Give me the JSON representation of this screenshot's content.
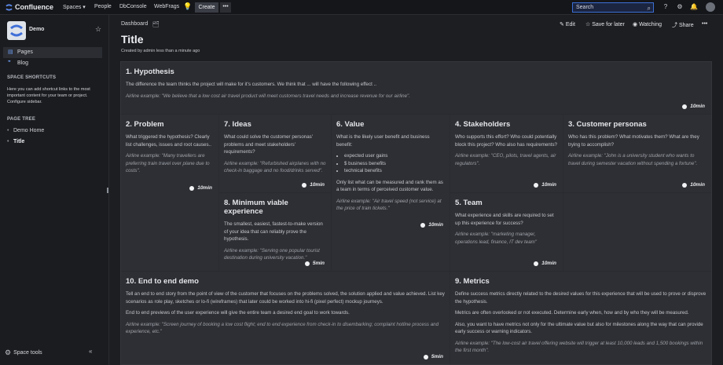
{
  "topnav": {
    "brand": "Confluence",
    "items": [
      "Spaces ▾",
      "People",
      "DbConsole",
      "WebFrags"
    ],
    "create": "Create",
    "more": "•••",
    "search_placeholder": "Search",
    "icons": [
      "lightbulb-icon",
      "help-icon",
      "settings-icon",
      "notifications-icon",
      "avatar"
    ]
  },
  "sidebar": {
    "space_name": "Demo",
    "nav": [
      {
        "label": "Pages",
        "icon": "pages-icon"
      },
      {
        "label": "Blog",
        "icon": "blog-icon"
      }
    ],
    "shortcuts_head": "SPACE SHORTCUTS",
    "shortcuts_text": "Here you can add shortcut links to the most important content for your team or project. Configure sidebar.",
    "tree_head": "PAGE TREE",
    "tree": [
      "Demo Home",
      "Title"
    ],
    "space_tools": "Space tools",
    "collapse": "«"
  },
  "page": {
    "breadcrumb": "Dashboard",
    "actions": {
      "edit": "Edit",
      "save": "Save for later",
      "watch": "Watching",
      "share": "Share",
      "more": "•••"
    },
    "title": "Title",
    "byline": "Created by admin less than a minute ago"
  },
  "cards": {
    "hypothesis": {
      "title": "1. Hypothesis",
      "text": "The difference the team thinks the project will make for it's customers. We think that ... will have the following effect ..",
      "example": "Airline example: \"We believe that a low cost air travel product will meet customers travel needs and increase revenue for our airline\".",
      "time": "10min"
    },
    "problem": {
      "title": "2. Problem",
      "text": "What triggered the hypothesis? Clearly list challenges, issues and root causes..",
      "example": "Airline example: \"Many travellers are preferring train travel over plane due to costs\".",
      "time": "10min"
    },
    "ideas": {
      "title": "7. Ideas",
      "text": "What could solve the customer personas' problems and meet stakeholders' requirements?",
      "example": "Airline example: \"Refurbished airplanes with no check-in baggage and no food/drinks served\".",
      "time": "10min"
    },
    "value": {
      "title": "6. Value",
      "text": "What is the likely user benefit and business benefit:",
      "bullets": [
        "expected user gains",
        "$ business benefits",
        "technical benefits"
      ],
      "text2": "Only list what can be measured and rank them as a team in terms of perceived customer value.",
      "example": "Airline example: \"Air travel speed (not service) at the price of train tickets.\"",
      "time": "10min"
    },
    "stakeholders": {
      "title": "4. Stakeholders",
      "text": "Who supports this effort? Who could potentially block this project? Who also has requirements?",
      "example": "Airline example: \"CEO, pilots, travel agents, air regulators\".",
      "time": "10min"
    },
    "personas": {
      "title": "3. Customer personas",
      "text": "Who has this problem? What motivates them? What are they trying to accomplish?",
      "example": "Airline example: \"John is a university student who wants to travel during semester vacation without spending a fortune\".",
      "time": "10min"
    },
    "mvp": {
      "title": "8. Minimum viable experience",
      "text": "The smallest, easiest, fastest-to-make version of your idea that can reliably prove the hypothesis.",
      "example": "Airline example: \"Serving one popular tourist destination during university vacation.\"",
      "time": "5min"
    },
    "team": {
      "title": "5. Team",
      "text": "What experience and skills are required to set up this experience for success?",
      "example": "Airline example: \"marketing manager, operations lead, finance, IT dev team\"",
      "time": "10min"
    },
    "demo": {
      "title": "10. End to end demo",
      "text": "Tell an end to end story from the point of view of the customer that focuses on the problems solved, the solution applied and value achieved. List key scenarios as role play, sketches or lo-fi (wireframes) that later could be worked into hi-fi (pixel perfect) mockup journeys.",
      "text2": "End to end previews of the user experience will give the entire team a desired end goal to work towards.",
      "example": "Airline example: \"Screen journey of booking a low cost flight; end to end experience from check-in to disembarking; complaint hotline process and experience, etc.\"",
      "time": "5min"
    },
    "metrics": {
      "title": "9. Metrics",
      "text": "Define success metrics directly related to the desired values for this experience that will be used to prove or disprove the hypothesis.",
      "text2": "Metrics are often overlooked or not executed. Determine early when, how and by who they will be measured.",
      "text3": "Also, you want to have metrics not only for the ultimate value but also for milestones along the way that can provide early success or warning indicators.",
      "example": "Airline example: \"The low-cost air travel offering website will trigger at least 10,000 leads and 1,500 bookings within the first month\"."
    }
  }
}
